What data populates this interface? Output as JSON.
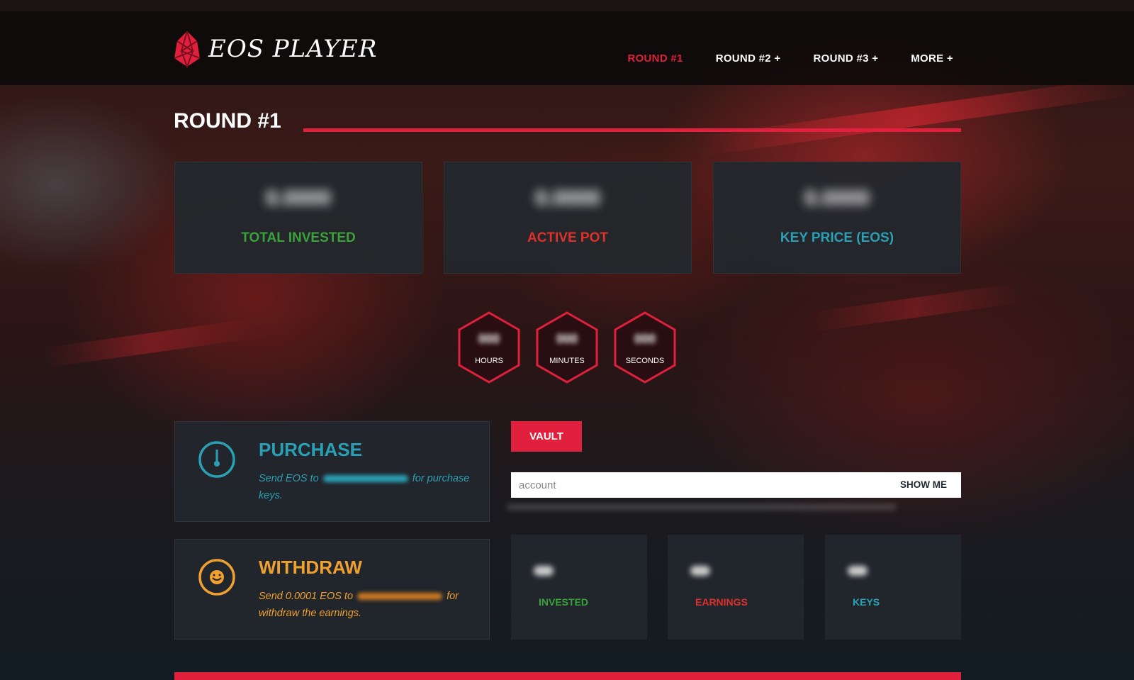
{
  "header": {
    "logo_text": "EOS PLAYER",
    "nav": [
      {
        "label": "ROUND #1",
        "active": true
      },
      {
        "label": "ROUND #2 +",
        "active": false
      },
      {
        "label": "ROUND #3 +",
        "active": false
      },
      {
        "label": "MORE +",
        "active": false
      }
    ]
  },
  "round": {
    "title": "ROUND #1"
  },
  "stats": [
    {
      "value": "0.0000",
      "label": "TOTAL INVESTED",
      "color": "#3aa23a"
    },
    {
      "value": "0.0000",
      "label": "ACTIVE POT",
      "color": "#e0302c"
    },
    {
      "value": "0.0000",
      "label": "KEY PRICE (EOS)",
      "color": "#2aa0b4"
    }
  ],
  "timer": [
    {
      "value": "000",
      "label": "HOURS"
    },
    {
      "value": "000",
      "label": "MINUTES"
    },
    {
      "value": "000",
      "label": "SECONDS"
    }
  ],
  "purchase": {
    "title": "PURCHASE",
    "desc_before": "Send EOS to",
    "desc_after": "for purchase keys.",
    "color": "#2aa0b4"
  },
  "withdraw": {
    "title": "WITHDRAW",
    "desc_before": "Send 0.0001 EOS to",
    "desc_after": "for withdraw the earnings.",
    "color": "#f0a030"
  },
  "vault": {
    "button_label": "VAULT",
    "input_placeholder": "account",
    "input_value": "",
    "show_me_label": "SHOW ME"
  },
  "vault_stats": [
    {
      "label": "INVESTED",
      "color": "#3aa23a"
    },
    {
      "label": "EARNINGS",
      "color": "#e0302c"
    },
    {
      "label": "KEYS",
      "color": "#2aa0b4"
    }
  ],
  "colors": {
    "accent": "#e0203c",
    "card": "#22262c"
  }
}
